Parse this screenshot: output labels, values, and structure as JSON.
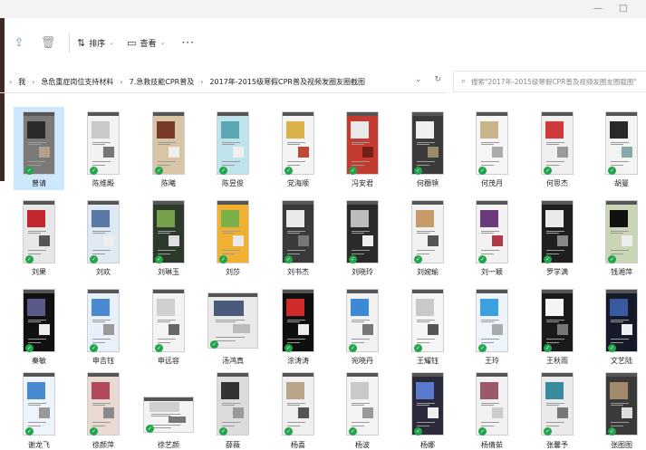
{
  "toolbar": {
    "share_icon": "share-icon",
    "delete_icon": "delete-icon",
    "sort_label": "排序",
    "view_label": "查看",
    "more_label": "···"
  },
  "address": {
    "crumbs": [
      "我",
      "急危重症岗位支持材料",
      "7.急救技能CPR普及",
      "2017年-2015级寒假CPR普及视频发圈友圈截图"
    ]
  },
  "search": {
    "placeholder": "搜索\"2017年-2015级寒假CPR普及视频发圈友圈截图\""
  },
  "files": [
    {
      "name": "曾请",
      "c": [
        "#7a7a7a",
        "#2b2b2b",
        "#b2a08a"
      ],
      "sel": true
    },
    {
      "name": "陈维殿",
      "c": [
        "#f2f2f2",
        "#c9c9c9",
        "#777"
      ]
    },
    {
      "name": "陈曦",
      "c": [
        "#d8c5a5",
        "#7a3a2a",
        "#eee"
      ]
    },
    {
      "name": "陈昱俊",
      "c": [
        "#bfe3ea",
        "#5aa6b3",
        "#f0f0f0"
      ]
    },
    {
      "name": "党海顺",
      "c": [
        "#f4f4f4",
        "#d9b24a",
        "#c04a3a"
      ]
    },
    {
      "name": "冯安君",
      "c": [
        "#c23b2e",
        "#e9e9e9",
        "#7a1e18"
      ]
    },
    {
      "name": "何頵顇",
      "c": [
        "#3b3b3b",
        "#f0f0f0",
        "#9b8a6a"
      ]
    },
    {
      "name": "何茂月",
      "c": [
        "#f6f6f6",
        "#c8b58a",
        "#aaa"
      ]
    },
    {
      "name": "何思杰",
      "c": [
        "#efefef",
        "#d03a3a",
        "#999"
      ]
    },
    {
      "name": "胡曼",
      "c": [
        "#f3f3f3",
        "#2a2a2a",
        "#8aa"
      ]
    },
    {
      "name": "刘果",
      "c": [
        "#e7e7e7",
        "#c0282e",
        "#555"
      ]
    },
    {
      "name": "刘欢",
      "c": [
        "#dfe9f3",
        "#5a78a6",
        "#eee"
      ]
    },
    {
      "name": "刘琳玉",
      "c": [
        "#2b3a2a",
        "#76a04a",
        "#ddd"
      ]
    },
    {
      "name": "刘莎",
      "c": [
        "#f0b030",
        "#7ab04a",
        "#e9e9e9"
      ]
    },
    {
      "name": "刘书杰",
      "c": [
        "#3a3a3a",
        "#e9e9e9",
        "#777"
      ]
    },
    {
      "name": "刘晓玲",
      "c": [
        "#2a2a2a",
        "#bcbcbc",
        "#eee"
      ]
    },
    {
      "name": "刘婉瑜",
      "c": [
        "#f1f1f1",
        "#c89a6a",
        "#555"
      ]
    },
    {
      "name": "刘一颖",
      "c": [
        "#f2f2f2",
        "#6a3a7a",
        "#b13a4a"
      ]
    },
    {
      "name": "罗学满",
      "c": [
        "#1f1f1f",
        "#eaeaea",
        "#888"
      ]
    },
    {
      "name": "钱湘萍",
      "c": [
        "#c9d6b6",
        "#111",
        "#eee"
      ]
    },
    {
      "name": "秦敏",
      "c": [
        "#111",
        "#5a5a8a",
        "#eee"
      ]
    },
    {
      "name": "申吉钰",
      "c": [
        "#e8f1fb",
        "#4a8ad0",
        "#999"
      ]
    },
    {
      "name": "申远容",
      "c": [
        "#f3f3f3",
        "#cfcfcf",
        "#666"
      ]
    },
    {
      "name": "汤鸿真",
      "c": [
        "#e9e9e9",
        "#4a5a7a",
        "#bbb"
      ],
      "wide": true
    },
    {
      "name": "涂涛涛",
      "c": [
        "#0f0f0f",
        "#d02a2a",
        "#eee"
      ]
    },
    {
      "name": "宛晓丹",
      "c": [
        "#f2f2f2",
        "#3b8ad8",
        "#777"
      ]
    },
    {
      "name": "王耀钰",
      "c": [
        "#f6f6f6",
        "#c9c9c9",
        "#555"
      ]
    },
    {
      "name": "王玲",
      "c": [
        "#eef4fb",
        "#3aa0e0",
        "#aaa"
      ]
    },
    {
      "name": "王秋雨",
      "c": [
        "#1a1a1a",
        "#f4f4f4",
        "#777"
      ]
    },
    {
      "name": "文艺陆",
      "c": [
        "#141a2a",
        "#3a5aa0",
        "#eee"
      ]
    },
    {
      "name": "谢龙飞",
      "c": [
        "#eef4fb",
        "#4a8ad0",
        "#999"
      ]
    },
    {
      "name": "徐颜萍",
      "c": [
        "#e9d9d3",
        "#b04a5a",
        "#888"
      ]
    },
    {
      "name": "徐艺颜",
      "c": [
        "#f4f4f4",
        "#cfcfcf",
        "#777"
      ],
      "short": true
    },
    {
      "name": "薛薇",
      "c": [
        "#dcdcdc",
        "#333",
        "#999"
      ]
    },
    {
      "name": "杨喜",
      "c": [
        "#efefef",
        "#b9a58a",
        "#555"
      ]
    },
    {
      "name": "杨波",
      "c": [
        "#f3f3f3",
        "#c9c9c9",
        "#999"
      ]
    },
    {
      "name": "杨娜",
      "c": [
        "#2a2a3a",
        "#5a7ad0",
        "#eee"
      ]
    },
    {
      "name": "杨倩茹",
      "c": [
        "#f1f1f1",
        "#9a5a6a",
        "#ccc"
      ]
    },
    {
      "name": "张馨予",
      "c": [
        "#eaeaea",
        "#3a8aa0",
        "#777"
      ]
    },
    {
      "name": "张图图",
      "c": [
        "#3a3a3a",
        "#a08a6a",
        "#ddd"
      ]
    }
  ]
}
